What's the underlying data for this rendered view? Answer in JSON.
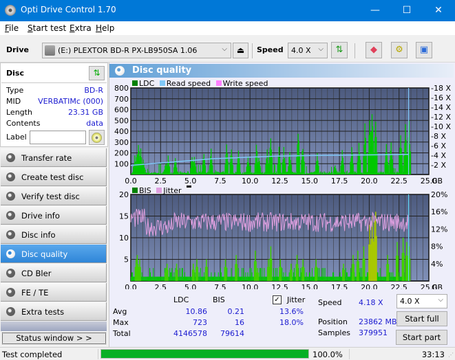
{
  "window": {
    "title": "Opti Drive Control 1.70",
    "minimize": "—",
    "maximize": "☐",
    "close": "✕"
  },
  "menu": [
    {
      "label": "File",
      "accel": "F",
      "rest": "ile"
    },
    {
      "label": "Start test",
      "accel": "S",
      "rest": "tart test"
    },
    {
      "label": "Extra",
      "accel": "E",
      "rest": "xtra"
    },
    {
      "label": "Help",
      "accel": "H",
      "rest": "elp"
    }
  ],
  "toolbar": {
    "drive_label": "Drive",
    "drive_value": "(E:)  PLEXTOR BD-R  PX-LB950SA 1.06",
    "eject_icon": "⏏",
    "speed_label": "Speed",
    "speed_value": "4.0 X",
    "chevron": "⌵"
  },
  "disc": {
    "header": "Disc",
    "rows": [
      {
        "key": "Type",
        "value": "BD-R"
      },
      {
        "key": "MID",
        "value": "VERBATIMc (000)"
      },
      {
        "key": "Length",
        "value": "23.31 GB"
      },
      {
        "key": "Contents",
        "value": "data"
      }
    ],
    "label_key": "Label",
    "label_value": ""
  },
  "nav": [
    {
      "label": "Transfer rate",
      "active": false
    },
    {
      "label": "Create test disc",
      "active": false
    },
    {
      "label": "Verify test disc",
      "active": false
    },
    {
      "label": "Drive info",
      "active": false
    },
    {
      "label": "Disc info",
      "active": false
    },
    {
      "label": "Disc quality",
      "active": true
    },
    {
      "label": "CD Bler",
      "active": false
    },
    {
      "label": "FE / TE",
      "active": false
    },
    {
      "label": "Extra tests",
      "active": false
    }
  ],
  "status_window_button": "Status window > >",
  "panel": {
    "title": "Disc quality"
  },
  "chart_data": [
    {
      "type": "bar",
      "title": "LDC",
      "legend": [
        {
          "name": "LDC",
          "color": "#008000"
        },
        {
          "name": "Read speed",
          "color": "#80c8f8"
        },
        {
          "name": "Write speed",
          "color": "#ff80ff"
        }
      ],
      "legend_position": "top-left",
      "xlabel": "GB",
      "x_ticks": [
        "0.0",
        "2.5",
        "5.0",
        "7.5",
        "10.0",
        "12.5",
        "15.0",
        "17.5",
        "20.0",
        "22.5",
        "25.0"
      ],
      "xlim": [
        0,
        25
      ],
      "y_ticks": [
        "100",
        "200",
        "300",
        "400",
        "500",
        "600",
        "700",
        "800"
      ],
      "ylim": [
        0,
        800
      ],
      "y2_ticks": [
        "2 X",
        "4 X",
        "6 X",
        "8 X",
        "10 X",
        "12 X",
        "14 X",
        "16 X",
        "18 X"
      ],
      "y2lim": [
        0,
        18
      ],
      "grid": true,
      "ldc_peaks": [
        [
          0.3,
          180
        ],
        [
          0.5,
          240
        ],
        [
          0.6,
          320
        ],
        [
          0.8,
          250
        ],
        [
          1.0,
          150
        ],
        [
          2.9,
          120
        ],
        [
          3.1,
          200
        ],
        [
          3.7,
          190
        ],
        [
          5.1,
          180
        ],
        [
          5.3,
          170
        ],
        [
          6.1,
          250
        ],
        [
          6.7,
          260
        ],
        [
          8.0,
          280
        ],
        [
          8.4,
          260
        ],
        [
          9.0,
          250
        ],
        [
          9.8,
          180
        ],
        [
          10.5,
          300
        ],
        [
          10.7,
          200
        ],
        [
          11.4,
          240
        ],
        [
          11.7,
          400
        ],
        [
          12.4,
          280
        ],
        [
          12.8,
          260
        ],
        [
          13.3,
          230
        ],
        [
          14.0,
          440
        ],
        [
          14.4,
          310
        ],
        [
          15.6,
          220
        ],
        [
          17.1,
          100
        ],
        [
          17.7,
          230
        ],
        [
          18.5,
          280
        ],
        [
          19.1,
          310
        ],
        [
          19.6,
          490
        ],
        [
          20.0,
          580
        ],
        [
          20.2,
          720
        ],
        [
          20.5,
          500
        ],
        [
          21.4,
          300
        ],
        [
          21.8,
          330
        ],
        [
          22.6,
          430
        ],
        [
          23.0,
          480
        ],
        [
          23.3,
          520
        ]
      ],
      "read_speed": [
        [
          0,
          1.9
        ],
        [
          1.0,
          2.1
        ],
        [
          2.0,
          2.3
        ],
        [
          3.0,
          2.5
        ],
        [
          4.0,
          2.7
        ],
        [
          5.0,
          2.9
        ],
        [
          6.0,
          3.1
        ],
        [
          7.0,
          3.3
        ],
        [
          8.0,
          3.4
        ],
        [
          9.0,
          3.5
        ],
        [
          10.0,
          3.6
        ],
        [
          11.0,
          3.7
        ],
        [
          12.0,
          3.8
        ],
        [
          13.0,
          3.85
        ],
        [
          15.0,
          3.95
        ],
        [
          17.0,
          4.0
        ],
        [
          19.0,
          4.05
        ],
        [
          21.0,
          4.1
        ],
        [
          23.3,
          4.2
        ]
      ],
      "end_marker_gb": 23.3
    },
    {
      "type": "bar",
      "title": "BIS",
      "legend": [
        {
          "name": "BIS",
          "color": "#008000"
        },
        {
          "name": "Jitter",
          "color": "#e0a0e0"
        }
      ],
      "legend_position": "top-left",
      "xlabel": "GB",
      "x_ticks": [
        "0.0",
        "2.5",
        "5.0",
        "7.5",
        "10.0",
        "12.5",
        "15.0",
        "17.5",
        "20.0",
        "22.5",
        "25.0"
      ],
      "xlim": [
        0,
        25
      ],
      "y_ticks": [
        "5",
        "10",
        "15",
        "20"
      ],
      "ylim": [
        0,
        20
      ],
      "y2_ticks": [
        "4%",
        "8%",
        "12%",
        "16%",
        "20%"
      ],
      "y2lim": [
        0,
        20
      ],
      "grid": true,
      "bis_peaks": [
        [
          0.4,
          5
        ],
        [
          0.5,
          6
        ],
        [
          0.7,
          5
        ],
        [
          2.9,
          3
        ],
        [
          3.0,
          4
        ],
        [
          3.8,
          4
        ],
        [
          5.2,
          4
        ],
        [
          5.5,
          5
        ],
        [
          6.3,
          5
        ],
        [
          7.9,
          5
        ],
        [
          8.8,
          6
        ],
        [
          10.4,
          7
        ],
        [
          10.6,
          3
        ],
        [
          11.5,
          5
        ],
        [
          11.7,
          8
        ],
        [
          12.5,
          5
        ],
        [
          13.4,
          4
        ],
        [
          13.9,
          6
        ],
        [
          14.4,
          5
        ],
        [
          15.5,
          5
        ],
        [
          17.8,
          4
        ],
        [
          18.6,
          6
        ],
        [
          19.0,
          7
        ],
        [
          19.5,
          8
        ],
        [
          20.0,
          13
        ],
        [
          20.2,
          15
        ],
        [
          20.4,
          14
        ],
        [
          20.5,
          16
        ],
        [
          21.5,
          6
        ],
        [
          22.3,
          9
        ],
        [
          22.8,
          10
        ],
        [
          23.1,
          9
        ],
        [
          23.3,
          8
        ]
      ],
      "jitter_mean_pct": 13.6,
      "jitter_max_pct": 18.0,
      "end_marker_gb": 23.3
    }
  ],
  "stats": {
    "col_ldc": "LDC",
    "col_bis": "BIS",
    "jitter_checked": true,
    "jitter_label": "Jitter",
    "rows": [
      {
        "label": "Avg",
        "ldc": "10.86",
        "bis": "0.21",
        "jitter": "13.6%"
      },
      {
        "label": "Max",
        "ldc": "723",
        "bis": "16",
        "jitter": "18.0%"
      },
      {
        "label": "Total",
        "ldc": "4146578",
        "bis": "79614",
        "jitter": ""
      }
    ],
    "speed_label": "Speed",
    "speed_value": "4.18 X",
    "position_label": "Position",
    "position_value": "23862 MB",
    "samples_label": "Samples",
    "samples_value": "379951",
    "speed_select": "4.0 X",
    "start_full": "Start full",
    "start_part": "Start part"
  },
  "statusbar": {
    "text": "Test completed",
    "progress_fraction": 1.0,
    "progress_text": "100.0%",
    "elapsed": "33:13"
  }
}
